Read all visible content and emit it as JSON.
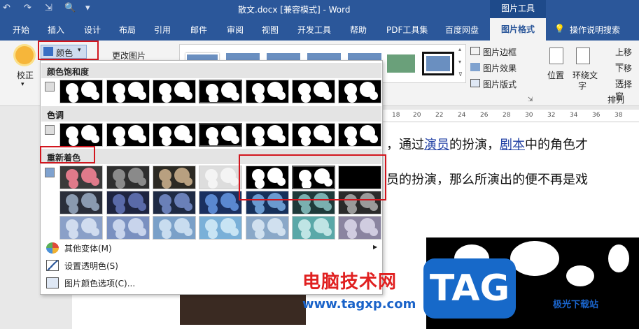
{
  "title_bar": {
    "doc_title": "散文.docx [兼容模式]  -  Word",
    "context_tools": "图片工具",
    "quick_access": [
      "↶",
      "↷",
      "⇲",
      "🔍",
      "▾"
    ]
  },
  "tabs": [
    "开始",
    "插入",
    "设计",
    "布局",
    "引用",
    "邮件",
    "审阅",
    "视图",
    "开发工具",
    "帮助",
    "PDF工具集",
    "百度网盘"
  ],
  "active_tab": "图片格式",
  "tell_me": "操作说明搜索",
  "ribbon": {
    "correct_label": "校正",
    "color_button": "颜色",
    "change_picture": "更改图片",
    "picture_border": "图片边框",
    "picture_effects": "图片效果",
    "picture_layout": "图片版式",
    "position_label": "位置",
    "wrap_text_line1": "环绕文",
    "wrap_text_line2": "字",
    "bring_forward": "上移一",
    "send_backward": "下移一",
    "selection_pane": "选择窗",
    "arrange_group": "排列"
  },
  "dropdown": {
    "saturation_header": "颜色饱和度",
    "tone_header": "色调",
    "recolor_header": "重新着色",
    "more_variations": "其他变体(M)",
    "set_transparent": "设置透明色(S)",
    "color_options": "图片颜色选项(C)..."
  },
  "ruler": [
    "18",
    "20",
    "22",
    "24",
    "26",
    "28",
    "30",
    "32",
    "34",
    "36",
    "38"
  ],
  "document": {
    "line1_prefix": "，通过",
    "line1_link1": "演员",
    "line1_mid": "的扮演，",
    "line1_link2": "剧本",
    "line1_suffix": "中的角色才",
    "line2": "员的扮演，那么所演出的便不再是戏"
  },
  "watermark": {
    "cn": "电脑技术网",
    "url": "www.tagxp.com",
    "tag": "TAG",
    "jg": "极光下载站"
  },
  "colors": {
    "word_blue": "#2b579a",
    "highlight_red": "#d2161e"
  }
}
